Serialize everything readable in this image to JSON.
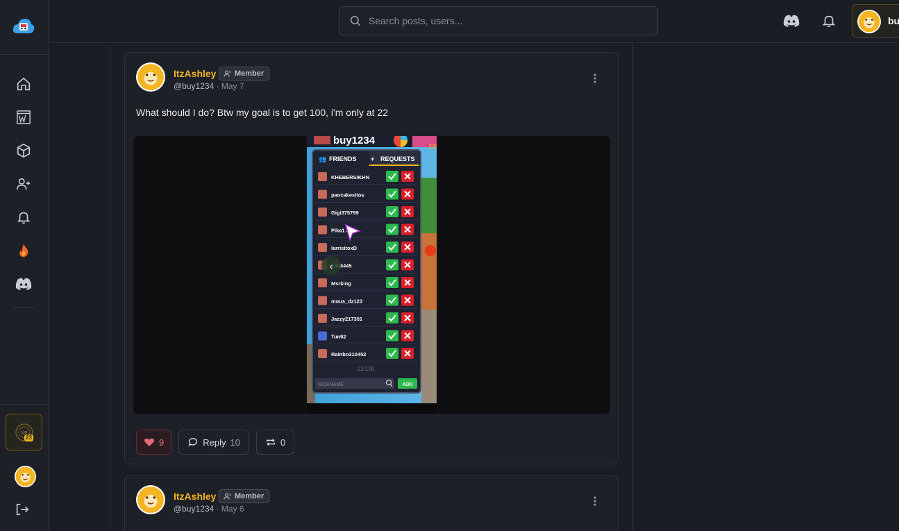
{
  "header": {
    "search": {
      "placeholder": "Search posts, users..."
    },
    "profile": {
      "name": "bu"
    }
  },
  "sidebar": {
    "xp_level": "23"
  },
  "posts": [
    {
      "author": "ItzAshley",
      "role": "Member",
      "handle": "@buy1234",
      "date": "· May 7",
      "text": "What should I do? Btw my goal is to get 100, i'm only at 22",
      "likes": "9",
      "reply_label": "Reply",
      "replies": "10",
      "reposts": "0"
    },
    {
      "author": "ItzAshley",
      "role": "Member",
      "handle": "@buy1234",
      "date": "· May 6"
    }
  ],
  "screenshot": {
    "username": "buy1234",
    "tab_friends": "FRIENDS",
    "tab_requests": "REQUESTS",
    "requests": [
      "KHEBERSIKHN",
      "pancakesitos",
      "Gigi375799",
      "Pika1  361",
      "larrisitoxD",
      "  o388445",
      "Msrking",
      "mous_dz123",
      "Jazzy217301",
      "Tun92",
      "Rainbo310452"
    ],
    "counter": "22/100",
    "nickname_placeholder": "NICKNAME",
    "add_label": "ADD"
  },
  "colors": {
    "accent": "#f5b421",
    "like": "#e56b7a",
    "accept": "#2db84d",
    "decline": "#d6202a"
  }
}
